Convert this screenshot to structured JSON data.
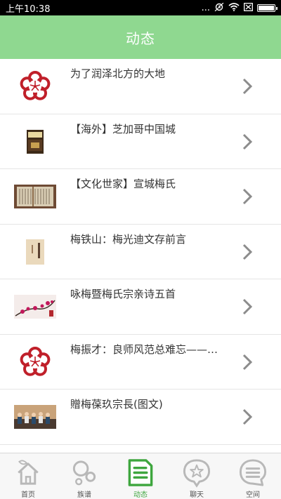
{
  "status_bar": {
    "time": "上午10:38",
    "dots": "...",
    "icons": [
      "alarm-icon",
      "wifi-icon",
      "no-sim-icon",
      "battery-icon"
    ]
  },
  "header": {
    "title": "动态"
  },
  "colors": {
    "header_bg": "#8fd890",
    "active_tab": "#3ea63e",
    "plum_red": "#c0202a"
  },
  "feed": [
    {
      "title": "为了润泽北方的大地",
      "thumb": "plum-logo"
    },
    {
      "title": "【海外】芝加哥中国城",
      "thumb": "book-cover"
    },
    {
      "title": "【文化世家】宣城梅氏",
      "thumb": "manuscript-photo"
    },
    {
      "title": "梅铁山：梅光迪文存前言",
      "thumb": "book-cover-light"
    },
    {
      "title": "咏梅暨梅氏宗亲诗五首",
      "thumb": "plum-blossom-painting"
    },
    {
      "title": "梅振才：良师风范总难忘——…",
      "thumb": "plum-logo"
    },
    {
      "title": "贈梅葆玖宗長(图文)",
      "thumb": "group-photo"
    }
  ],
  "tabs": [
    {
      "label": "首页",
      "icon": "home-icon",
      "active": false
    },
    {
      "label": "族谱",
      "icon": "family-tree-icon",
      "active": false
    },
    {
      "label": "动态",
      "icon": "news-document-icon",
      "active": true
    },
    {
      "label": "聊天",
      "icon": "chat-icon",
      "active": false
    },
    {
      "label": "空间",
      "icon": "space-icon",
      "active": false
    }
  ]
}
